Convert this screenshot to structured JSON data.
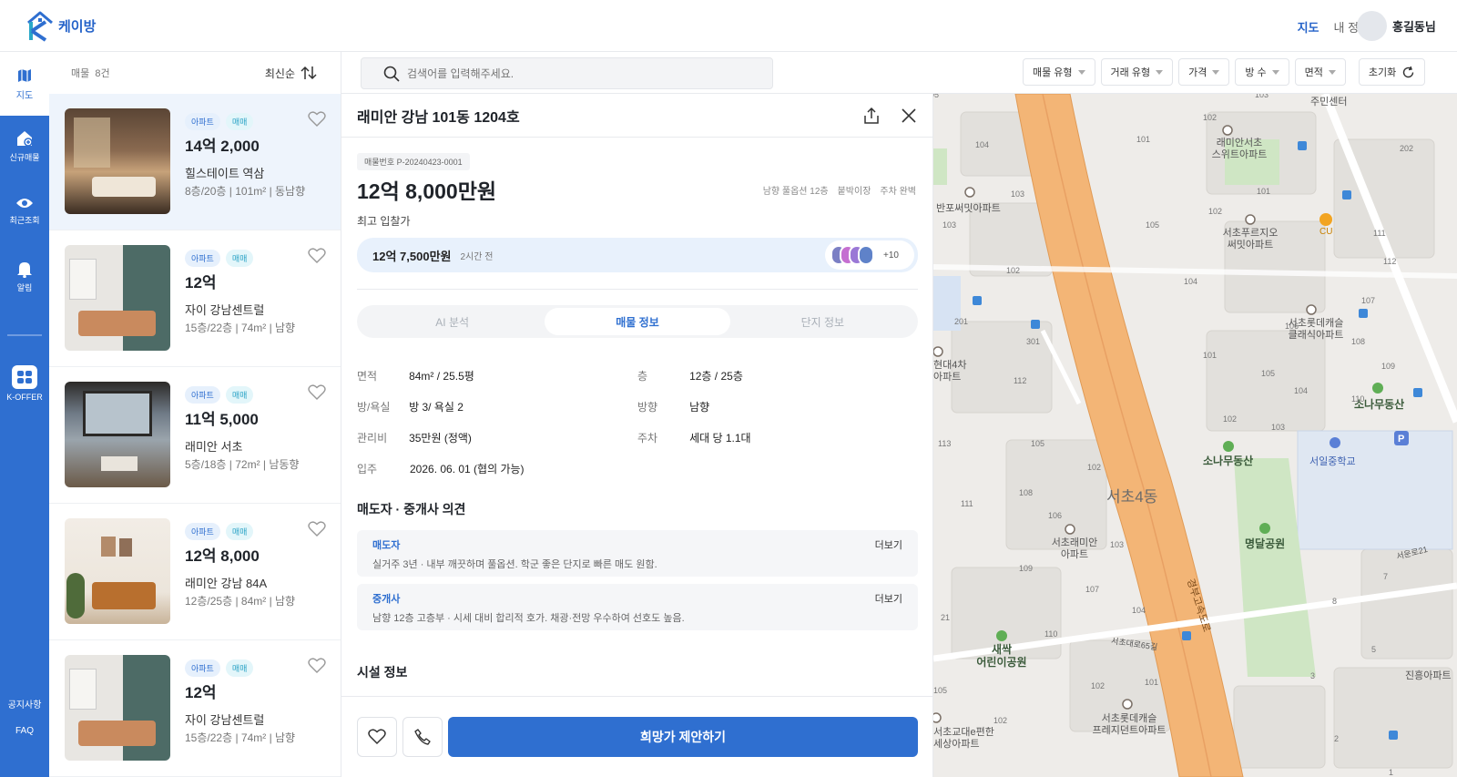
{
  "brand": {
    "name": "케이방",
    "color": "#2f6fd0"
  },
  "topnav": {
    "map": "지도",
    "myinfo": "내 정보",
    "user": "홍길동님"
  },
  "sidenav": {
    "map": "지도",
    "items": [
      {
        "label": "신규매물",
        "icon": "home-plus-icon"
      },
      {
        "label": "최근조회",
        "icon": "eye-icon"
      },
      {
        "label": "알림",
        "icon": "bell-icon"
      }
    ],
    "koffer": "K-OFFER",
    "notice": "공지사항",
    "faq": "FAQ"
  },
  "list": {
    "count_label": "매물",
    "count": "8건",
    "sort": "최신순",
    "items": [
      {
        "tag1": "아파트",
        "tag2": "매매",
        "price": "14억 2,000",
        "name": "힐스테이트 역삼",
        "meta": "8층/20층 | 101m² | 동남향"
      },
      {
        "tag1": "아파트",
        "tag2": "매매",
        "price": "12억",
        "name": "자이 강남센트럴",
        "meta": "15층/22층 | 74m² | 남향"
      },
      {
        "tag1": "아파트",
        "tag2": "매매",
        "price": "11억 5,000",
        "name": "래미안 서초",
        "meta": "5층/18층 | 72m² | 남동향"
      },
      {
        "tag1": "아파트",
        "tag2": "매매",
        "price": "12억 8,000",
        "name": "래미안 강남 84A",
        "meta": "12층/25층 | 84m² | 남향"
      },
      {
        "tag1": "아파트",
        "tag2": "매매",
        "price": "12억",
        "name": "자이 강남센트럴",
        "meta": "15층/22층 | 74m² | 남향"
      }
    ]
  },
  "search": {
    "placeholder": "검색어를 입력해주세요."
  },
  "filters": [
    "매물 유형",
    "거래 유형",
    "가격",
    "방 수",
    "면적"
  ],
  "reset": "초기화",
  "detail": {
    "title": "래미안 강남 101동 1204호",
    "listing_id": "매물번호 P-20240423-0001",
    "price": "12억 8,000만원",
    "features": [
      "남향 풀옵션 12층",
      "붙박이장",
      "주차 완벽"
    ],
    "bid_label": "최고 입찰가",
    "bid_price": "12억 7,500만원",
    "bid_time": "2시간 전",
    "bid_more": "+10",
    "tabs": [
      "AI 분석",
      "매물 정보",
      "단지 정보"
    ],
    "info": [
      {
        "l1": "면적",
        "v1": "84m² / 25.5평",
        "l2": "층",
        "v2": "12층 / 25층"
      },
      {
        "l1": "방/욕실",
        "v1": "방 3/ 욕실 2",
        "l2": "방향",
        "v2": "남향"
      },
      {
        "l1": "관리비",
        "v1": "35만원 (정액)",
        "l2": "주차",
        "v2": "세대 당 1.1대"
      },
      {
        "l1": "입주",
        "v1": "2026. 06. 01 (협의 가능)",
        "l2": "",
        "v2": ""
      }
    ],
    "opinion_title": "매도자 · 중개사 의견",
    "opinions": [
      {
        "who": "매도자",
        "text": "실거주 3년 · 내부 깨끗하며 풀옵션. 학군 좋은 단지로 빠른 매도 원함.",
        "more": "더보기"
      },
      {
        "who": "중개사",
        "text": "남향 12층 고층부 · 시세 대비 합리적 호가. 채광·전망 우수하여 선호도 높음.",
        "more": "더보기"
      }
    ],
    "facility_title": "시설 정보",
    "cta": "희망가 제안하기"
  },
  "map": {
    "district": "서초4동",
    "road": "경부고속도로",
    "street1": "서초대로65길",
    "street2": "서운로21",
    "places": [
      {
        "name": "주민센터"
      },
      {
        "name": "래미안서초\n스위트아파트"
      },
      {
        "name": "반포써밋아파트"
      },
      {
        "name": "서초푸르지오\n써밋아파트"
      },
      {
        "name": "CU"
      },
      {
        "name": "서초롯데캐슬\n클래식아파트"
      },
      {
        "name": "소나무동산"
      },
      {
        "name": "소나무동산"
      },
      {
        "name": "서일중학교"
      },
      {
        "name": "명달공원"
      },
      {
        "name": "서초래미안\n아파트"
      },
      {
        "name": "새싹\n어린이공원"
      },
      {
        "name": "서초롯데캐슬\n프레지던트아파트"
      },
      {
        "name": "서초교대e편한\n세상아파트"
      },
      {
        "name": "진흥아파트"
      },
      {
        "name": "현대4차\n아파트"
      }
    ],
    "numbers": [
      "105",
      "103",
      "102",
      "104",
      "101",
      "202",
      "103",
      "101",
      "102",
      "105",
      "111",
      "112",
      "103",
      "104",
      "201",
      "301",
      "102",
      "107",
      "106",
      "108",
      "109",
      "112",
      "101",
      "105",
      "104",
      "110",
      "102",
      "103",
      "113",
      "105",
      "102",
      "111",
      "108",
      "106",
      "103",
      "109",
      "107",
      "104",
      "110",
      "21",
      "102",
      "101",
      "105",
      "102",
      "3",
      "8",
      "5",
      "7",
      "2",
      "1"
    ]
  }
}
